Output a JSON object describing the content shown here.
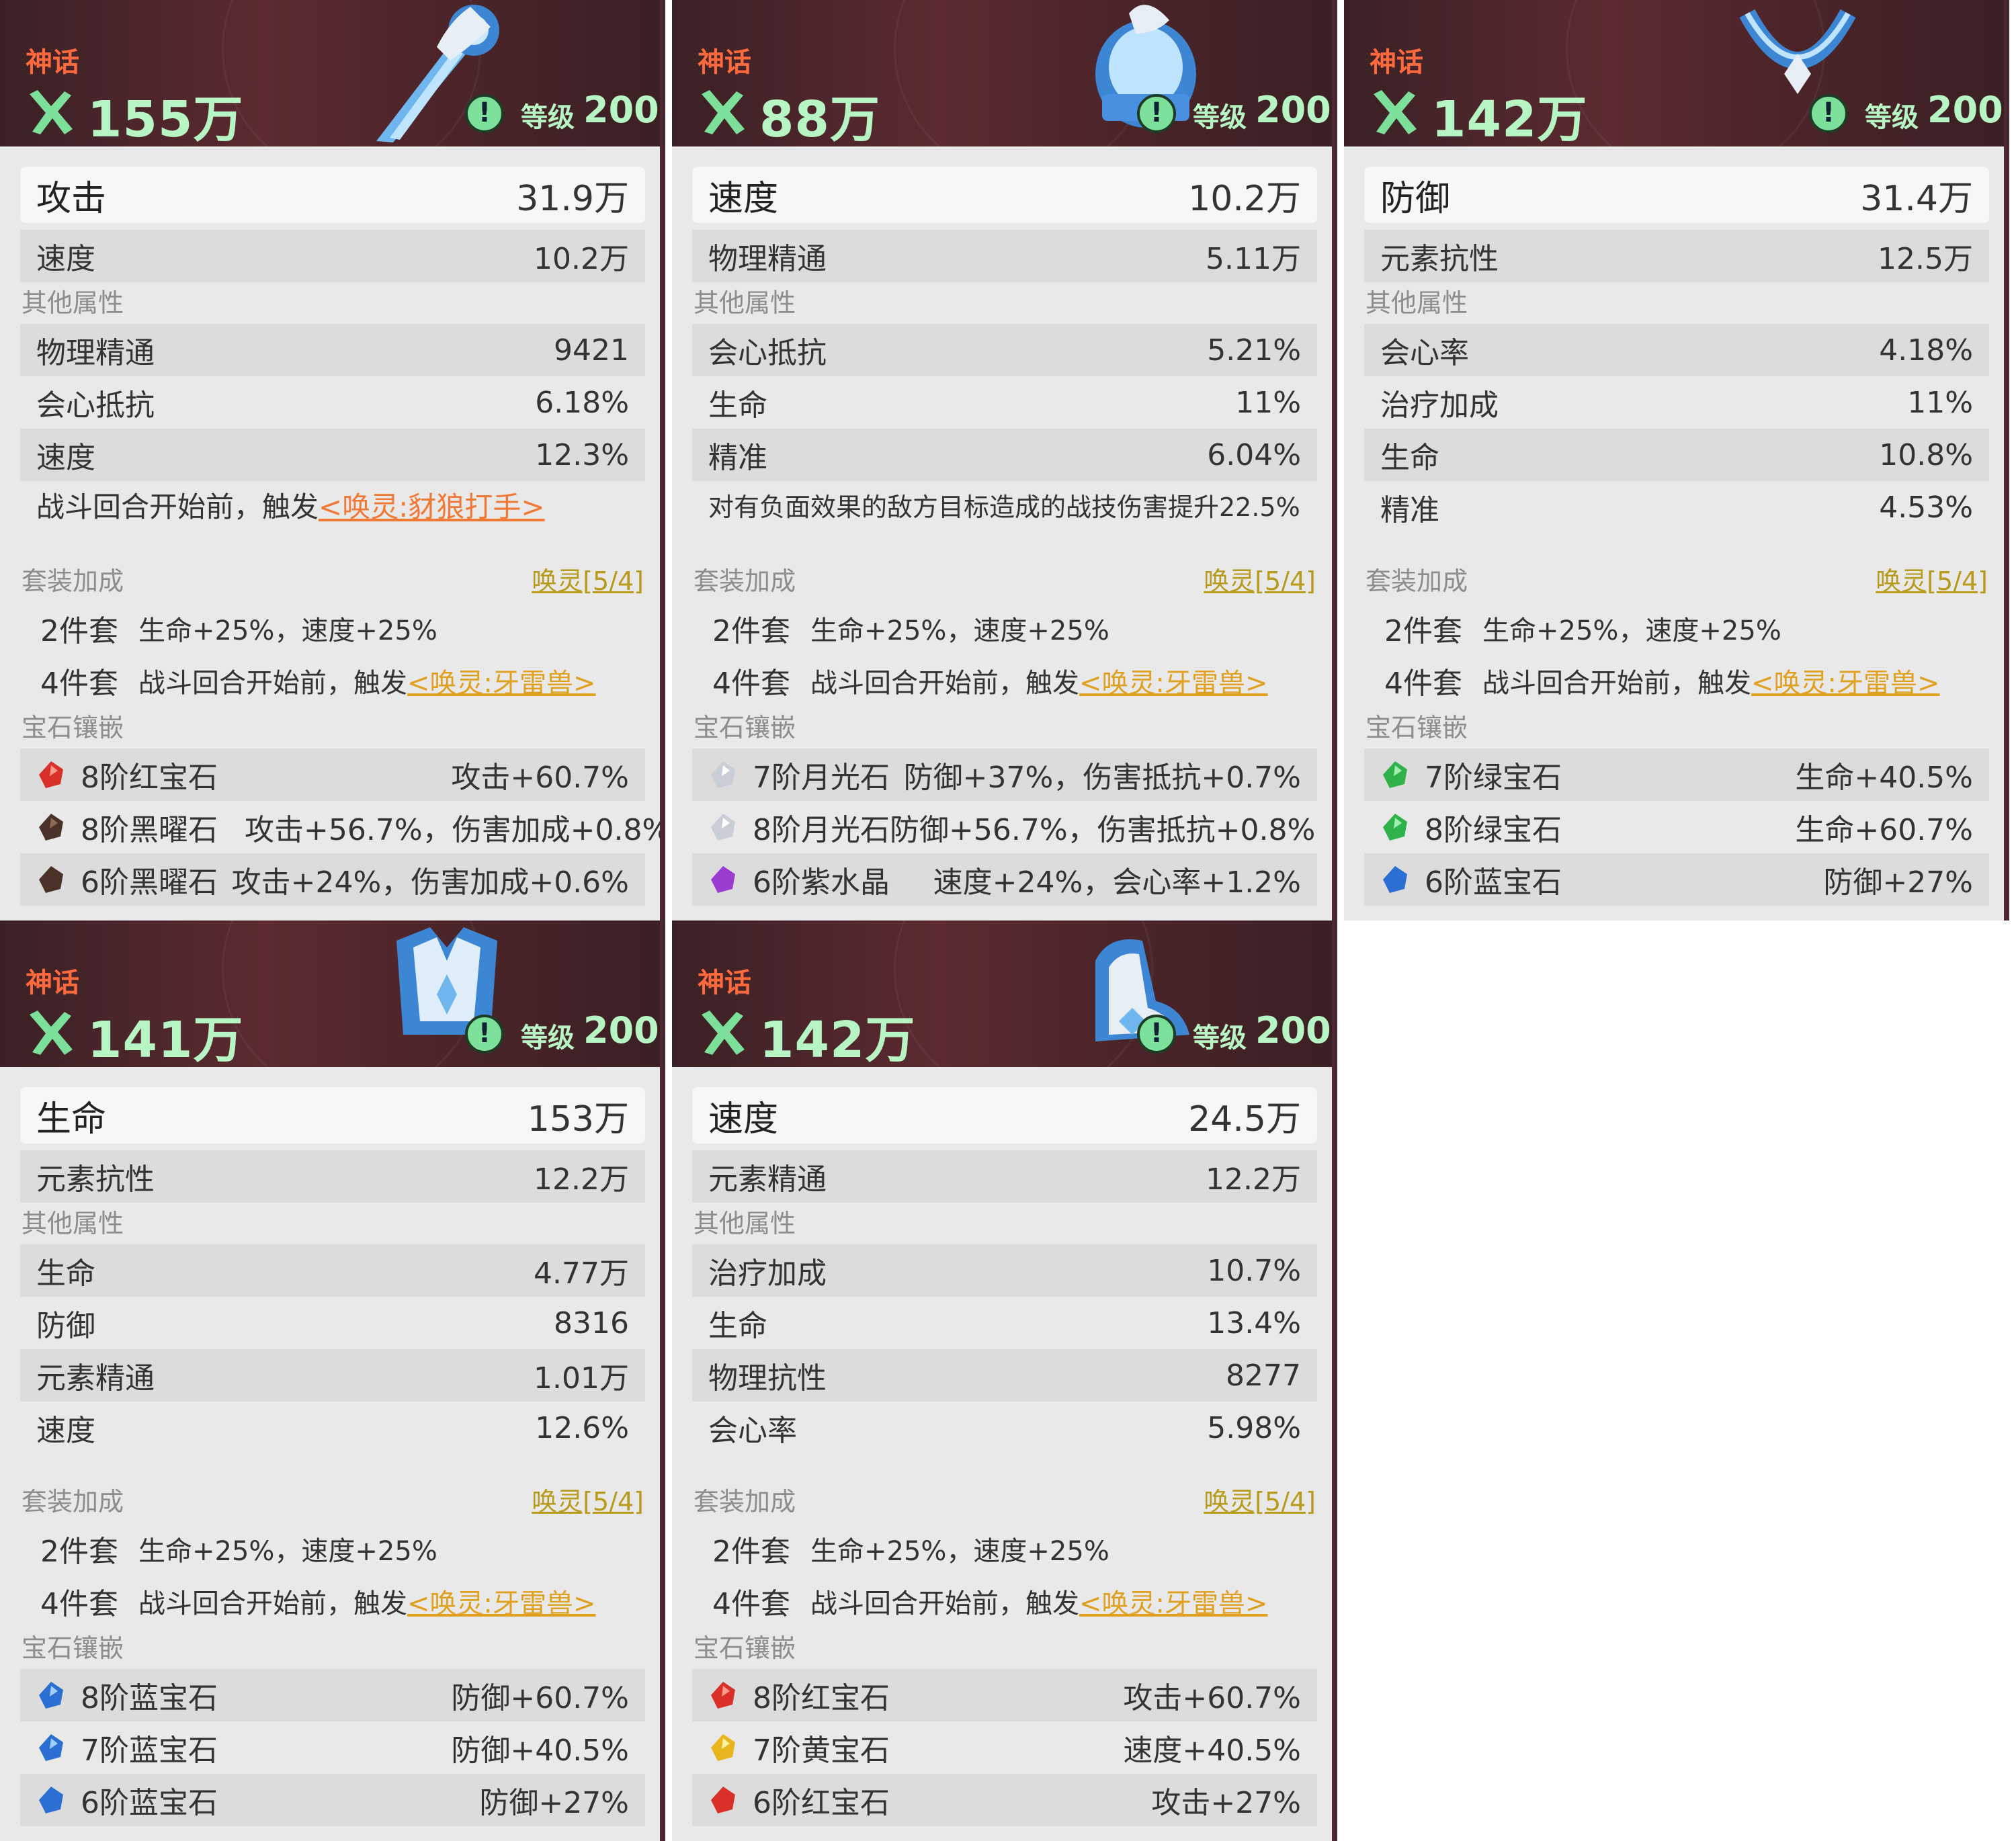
{
  "cards": [
    {
      "rarity": "神话",
      "power": "155万",
      "level_label": "等级",
      "level": "200",
      "main_stats": [
        {
          "name": "攻击",
          "value": "31.9万"
        },
        {
          "name": "速度",
          "value": "10.2万"
        }
      ],
      "other_label": "其他属性",
      "other_stats": [
        {
          "name": "物理精通",
          "value": "9421"
        },
        {
          "name": "会心抵抗",
          "value": "6.18%"
        },
        {
          "name": "速度",
          "value": "12.3%"
        }
      ],
      "special_text": "战斗回合开始前，触发",
      "special_link": "<唤灵:豺狼打手>",
      "set_label": "套装加成",
      "set_name": "唤灵[5/4]",
      "set2_label": "2件套",
      "set2_effect": "生命+25%，速度+25%",
      "set4_label": "4件套",
      "set4_effect": "战斗回合开始前，触发",
      "set4_link": "<唤灵:牙雷兽>",
      "gem_label": "宝石镶嵌",
      "gems": [
        {
          "name": "8阶红宝石",
          "effect": "攻击+60.7%",
          "color": "#d9302a"
        },
        {
          "name": "8阶黑曜石",
          "effect": "攻击+56.7%，伤害加成+0.8%",
          "color": "#4a3228"
        },
        {
          "name": "6阶黑曜石",
          "effect": "攻击+24%，伤害加成+0.6%",
          "color": "#4a3228"
        }
      ]
    },
    {
      "rarity": "神话",
      "power": "88万",
      "level_label": "等级",
      "level": "200",
      "main_stats": [
        {
          "name": "速度",
          "value": "10.2万"
        },
        {
          "name": "物理精通",
          "value": "5.11万"
        }
      ],
      "other_label": "其他属性",
      "other_stats": [
        {
          "name": "会心抵抗",
          "value": "5.21%"
        },
        {
          "name": "生命",
          "value": "11%"
        },
        {
          "name": "精准",
          "value": "6.04%"
        }
      ],
      "special_text": "对有负面效果的敌方目标造成的战技伤害提升22.5%",
      "special_link": "",
      "set_label": "套装加成",
      "set_name": "唤灵[5/4]",
      "set2_label": "2件套",
      "set2_effect": "生命+25%，速度+25%",
      "set4_label": "4件套",
      "set4_effect": "战斗回合开始前，触发",
      "set4_link": "<唤灵:牙雷兽>",
      "gem_label": "宝石镶嵌",
      "gems": [
        {
          "name": "7阶月光石",
          "effect": "防御+37%，伤害抵抗+0.7%",
          "color": "#c9ced6"
        },
        {
          "name": "8阶月光石",
          "effect": "防御+56.7%，伤害抵抗+0.8%",
          "color": "#c9ced6"
        },
        {
          "name": "6阶紫水晶",
          "effect": "速度+24%，会心率+1.2%",
          "color": "#9a3ccf"
        }
      ]
    },
    {
      "rarity": "神话",
      "power": "142万",
      "level_label": "等级",
      "level": "200",
      "main_stats": [
        {
          "name": "防御",
          "value": "31.4万"
        },
        {
          "name": "元素抗性",
          "value": "12.5万"
        }
      ],
      "other_label": "其他属性",
      "other_stats": [
        {
          "name": "会心率",
          "value": "4.18%"
        },
        {
          "name": "治疗加成",
          "value": "11%"
        },
        {
          "name": "生命",
          "value": "10.8%"
        },
        {
          "name": "精准",
          "value": "4.53%"
        }
      ],
      "special_text": "",
      "special_link": "",
      "set_label": "套装加成",
      "set_name": "唤灵[5/4]",
      "set2_label": "2件套",
      "set2_effect": "生命+25%，速度+25%",
      "set4_label": "4件套",
      "set4_effect": "战斗回合开始前，触发",
      "set4_link": "<唤灵:牙雷兽>",
      "gem_label": "宝石镶嵌",
      "gems": [
        {
          "name": "7阶绿宝石",
          "effect": "生命+40.5%",
          "color": "#2fb24a"
        },
        {
          "name": "8阶绿宝石",
          "effect": "生命+60.7%",
          "color": "#2fb24a"
        },
        {
          "name": "6阶蓝宝石",
          "effect": "防御+27%",
          "color": "#2a6fd1"
        }
      ]
    },
    {
      "rarity": "神话",
      "power": "141万",
      "level_label": "等级",
      "level": "200",
      "main_stats": [
        {
          "name": "生命",
          "value": "153万"
        },
        {
          "name": "元素抗性",
          "value": "12.2万"
        }
      ],
      "other_label": "其他属性",
      "other_stats": [
        {
          "name": "生命",
          "value": "4.77万"
        },
        {
          "name": "防御",
          "value": "8316"
        },
        {
          "name": "元素精通",
          "value": "1.01万"
        },
        {
          "name": "速度",
          "value": "12.6%"
        }
      ],
      "special_text": "",
      "special_link": "",
      "set_label": "套装加成",
      "set_name": "唤灵[5/4]",
      "set2_label": "2件套",
      "set2_effect": "生命+25%，速度+25%",
      "set4_label": "4件套",
      "set4_effect": "战斗回合开始前，触发",
      "set4_link": "<唤灵:牙雷兽>",
      "gem_label": "宝石镶嵌",
      "gems": [
        {
          "name": "8阶蓝宝石",
          "effect": "防御+60.7%",
          "color": "#2a6fd1"
        },
        {
          "name": "7阶蓝宝石",
          "effect": "防御+40.5%",
          "color": "#2a6fd1"
        },
        {
          "name": "6阶蓝宝石",
          "effect": "防御+27%",
          "color": "#2a6fd1"
        }
      ]
    },
    {
      "rarity": "神话",
      "power": "142万",
      "level_label": "等级",
      "level": "200",
      "main_stats": [
        {
          "name": "速度",
          "value": "24.5万"
        },
        {
          "name": "元素精通",
          "value": "12.2万"
        }
      ],
      "other_label": "其他属性",
      "other_stats": [
        {
          "name": "治疗加成",
          "value": "10.7%"
        },
        {
          "name": "生命",
          "value": "13.4%"
        },
        {
          "name": "物理抗性",
          "value": "8277"
        },
        {
          "name": "会心率",
          "value": "5.98%"
        }
      ],
      "special_text": "",
      "special_link": "",
      "set_label": "套装加成",
      "set_name": "唤灵[5/4]",
      "set2_label": "2件套",
      "set2_effect": "生命+25%，速度+25%",
      "set4_label": "4件套",
      "set4_effect": "战斗回合开始前，触发",
      "set4_link": "<唤灵:牙雷兽>",
      "gem_label": "宝石镶嵌",
      "gems": [
        {
          "name": "8阶红宝石",
          "effect": "攻击+60.7%",
          "color": "#d9302a"
        },
        {
          "name": "7阶黄宝石",
          "effect": "速度+40.5%",
          "color": "#e8b51e"
        },
        {
          "name": "6阶红宝石",
          "effect": "攻击+27%",
          "color": "#d9302a"
        }
      ]
    }
  ]
}
